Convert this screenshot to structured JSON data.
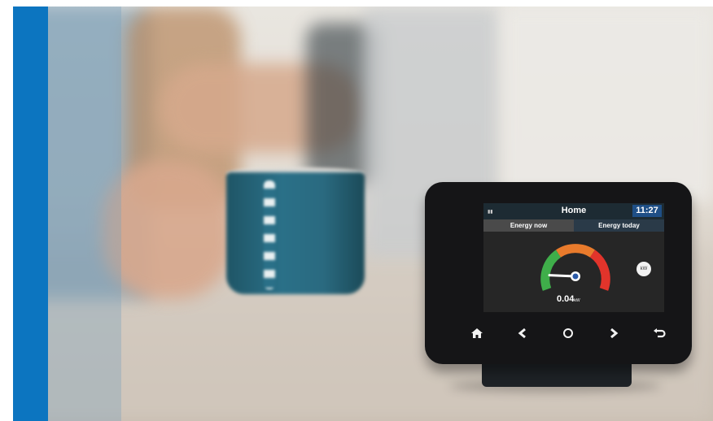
{
  "device": {
    "screen_title": "Home",
    "time": "11:27",
    "tabs": [
      "Energy now",
      "Energy today"
    ],
    "reading_value": "0.04",
    "reading_unit": "kW",
    "side_button": "kW",
    "gauge_level": 0.15,
    "icons": [
      "home-icon",
      "chevron-left-icon",
      "circle-icon",
      "chevron-right-icon",
      "back-arrow-icon"
    ]
  },
  "colors": {
    "brand_blue": "#0c75c0",
    "gauge_green": "#3fae4a",
    "gauge_orange": "#e97b2c",
    "gauge_red": "#e2342b"
  }
}
